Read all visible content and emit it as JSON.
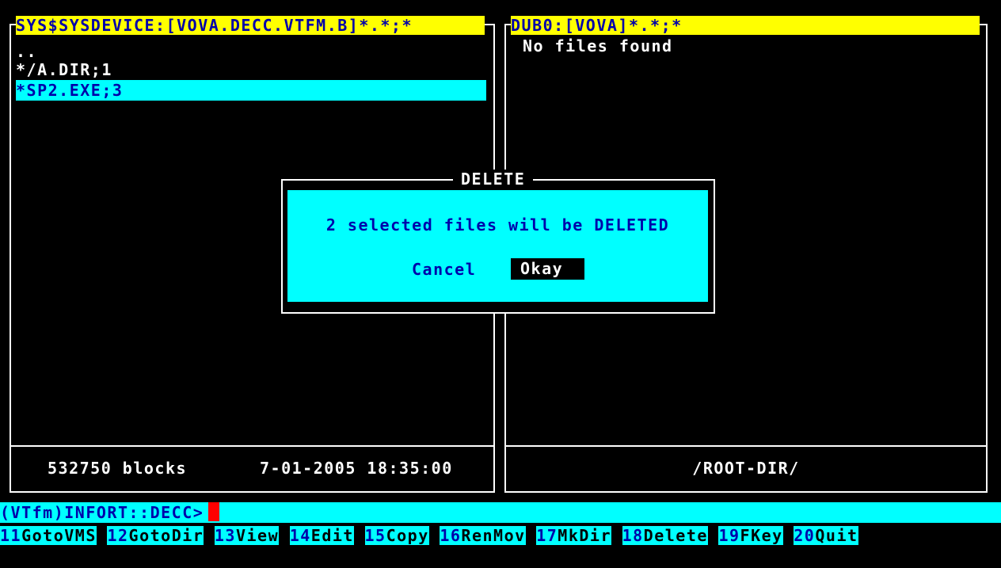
{
  "left_panel": {
    "header": "SYS$SYSDEVICE:[VOVA.DECC.VTFM.B]*.*;*",
    "files": [
      "..",
      "*/A.DIR;1",
      "*SP2.EXE;3"
    ],
    "selected_index": 2,
    "status_blocks": "532750 blocks",
    "status_datetime": "7-01-2005 18:35:00"
  },
  "right_panel": {
    "header": "DUB0:[VOVA]*.*;*",
    "message": "No files found",
    "status": "/ROOT-DIR/"
  },
  "dialog": {
    "title": "DELETE",
    "message": "2 selected files will be DELETED",
    "cancel_label": "Cancel",
    "okay_label": "Okay"
  },
  "command_line": {
    "prompt": "(VTfm)INFORT::DECC>"
  },
  "function_keys": [
    {
      "num": "11",
      "label": "GotoVMS"
    },
    {
      "num": "12",
      "label": "GotoDir"
    },
    {
      "num": "13",
      "label": "View"
    },
    {
      "num": "14",
      "label": "Edit"
    },
    {
      "num": "15",
      "label": "Copy"
    },
    {
      "num": "16",
      "label": "RenMov"
    },
    {
      "num": "17",
      "label": "MkDir"
    },
    {
      "num": "18",
      "label": "Delete"
    },
    {
      "num": "19",
      "label": "FKey"
    },
    {
      "num": "20",
      "label": "Quit"
    }
  ],
  "colors": {
    "background": "#000000",
    "header": "#ffff00",
    "selection": "#00ffff",
    "text_blue": "#0000aa",
    "cursor": "#ff0000"
  }
}
